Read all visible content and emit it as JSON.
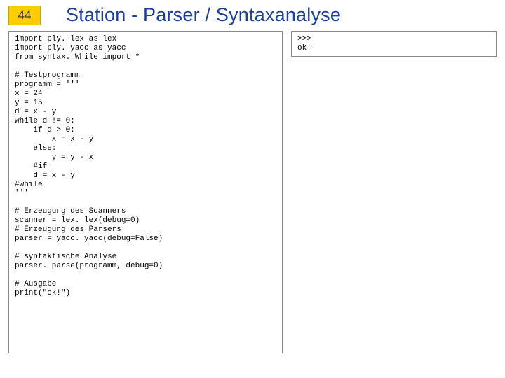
{
  "slide_number": "44",
  "title": "Station - Parser / Syntaxanalyse",
  "left_code": "import ply. lex as lex\nimport ply. yacc as yacc\nfrom syntax. While import *\n\n# Testprogramm\nprogramm = '''\nx = 24\ny = 15\nd = x - y\nwhile d != 0:\n    if d > 0:\n        x = x - y\n    else:\n        y = y - x\n    #if\n    d = x - y\n#while\n'''\n\n# Erzeugung des Scanners\nscanner = lex. lex(debug=0)\n# Erzeugung des Parsers\nparser = yacc. yacc(debug=False)\n\n# syntaktische Analyse\nparser. parse(programm, debug=0)\n\n# Ausgabe\nprint(\"ok!\")",
  "right_code": ">>> \nok!"
}
